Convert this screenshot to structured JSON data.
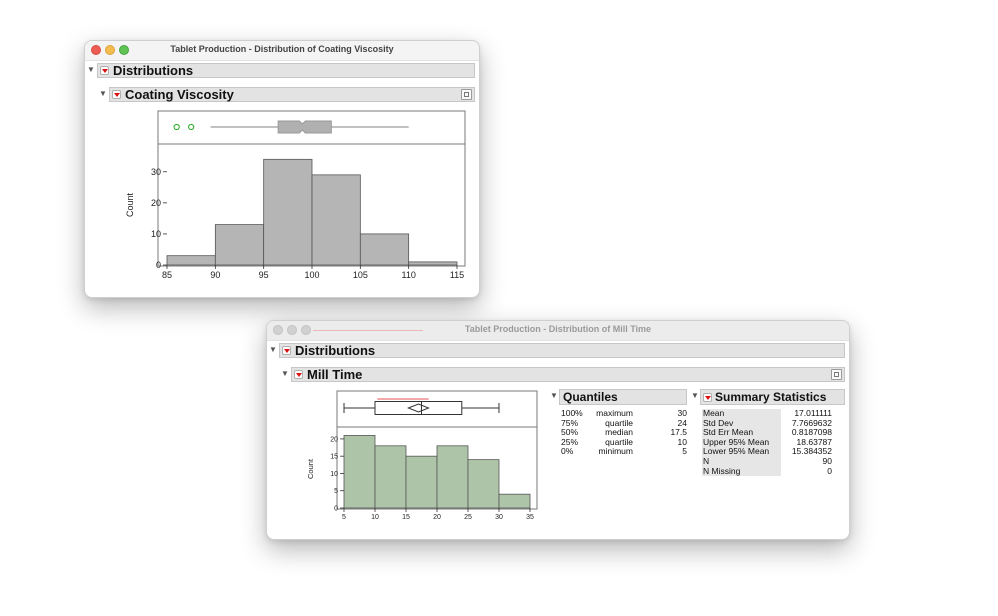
{
  "window1": {
    "title": "Tablet Production - Distribution of Coating Viscosity",
    "outline_title": "Distributions",
    "section_title": "Coating Viscosity",
    "histogram": {
      "ylabel": "Count",
      "xticks": [
        "85",
        "90",
        "95",
        "100",
        "105",
        "110",
        "115"
      ],
      "yticks": [
        "0",
        "10",
        "20",
        "30"
      ],
      "bar_color": "#b5b5b5"
    }
  },
  "window2": {
    "title": "Tablet Production - Distribution of Mill Time",
    "outline_title": "Distributions",
    "section_title": "Mill Time",
    "histogram": {
      "ylabel": "Count",
      "xticks": [
        "5",
        "10",
        "15",
        "20",
        "25",
        "30",
        "35"
      ],
      "yticks": [
        "0",
        "5",
        "10",
        "15",
        "20"
      ],
      "bar_color": "#adc4a9"
    },
    "quantiles": {
      "title": "Quantiles",
      "rows": [
        {
          "pct": "100%",
          "label": "maximum",
          "value": "30"
        },
        {
          "pct": "75%",
          "label": "quartile",
          "value": "24"
        },
        {
          "pct": "50%",
          "label": "median",
          "value": "17.5"
        },
        {
          "pct": "25%",
          "label": "quartile",
          "value": "10"
        },
        {
          "pct": "0%",
          "label": "minimum",
          "value": "5"
        }
      ]
    },
    "summary": {
      "title": "Summary Statistics",
      "rows": [
        {
          "label": "Mean",
          "value": "17.011111"
        },
        {
          "label": "Std Dev",
          "value": "7.7669632"
        },
        {
          "label": "Std Err Mean",
          "value": "0.8187098"
        },
        {
          "label": "Upper 95% Mean",
          "value": "18.63787"
        },
        {
          "label": "Lower 95% Mean",
          "value": "15.384352"
        },
        {
          "label": "N",
          "value": "90"
        },
        {
          "label": "N Missing",
          "value": "0"
        }
      ]
    }
  },
  "chart_data": [
    {
      "type": "bar",
      "xlabel": "",
      "ylabel": "Count",
      "bins": [
        [
          85,
          90
        ],
        [
          90,
          95
        ],
        [
          95,
          100
        ],
        [
          100,
          105
        ],
        [
          105,
          110
        ],
        [
          110,
          115
        ]
      ],
      "values": [
        3,
        13,
        34,
        29,
        10,
        1
      ],
      "xlim": [
        85,
        115
      ],
      "ylim": [
        0,
        37
      ],
      "boxplot": {
        "q1": 96.5,
        "median": 99,
        "q3": 102,
        "whisker_low": 89.5,
        "whisker_high": 110,
        "outliers": [
          86,
          87.5
        ]
      }
    },
    {
      "type": "bar",
      "xlabel": "",
      "ylabel": "Count",
      "bins": [
        [
          5,
          10
        ],
        [
          10,
          15
        ],
        [
          15,
          20
        ],
        [
          20,
          25
        ],
        [
          25,
          30
        ],
        [
          30,
          35
        ]
      ],
      "values": [
        21,
        18,
        15,
        18,
        14,
        4
      ],
      "xlim": [
        5,
        35
      ],
      "ylim": [
        0,
        22
      ],
      "boxplot": {
        "q1": 10,
        "median": 17.5,
        "q3": 24,
        "whisker_low": 5,
        "whisker_high": 30,
        "mean": 17.011111,
        "mean_ci": [
          15.384352,
          18.63787
        ]
      }
    }
  ]
}
